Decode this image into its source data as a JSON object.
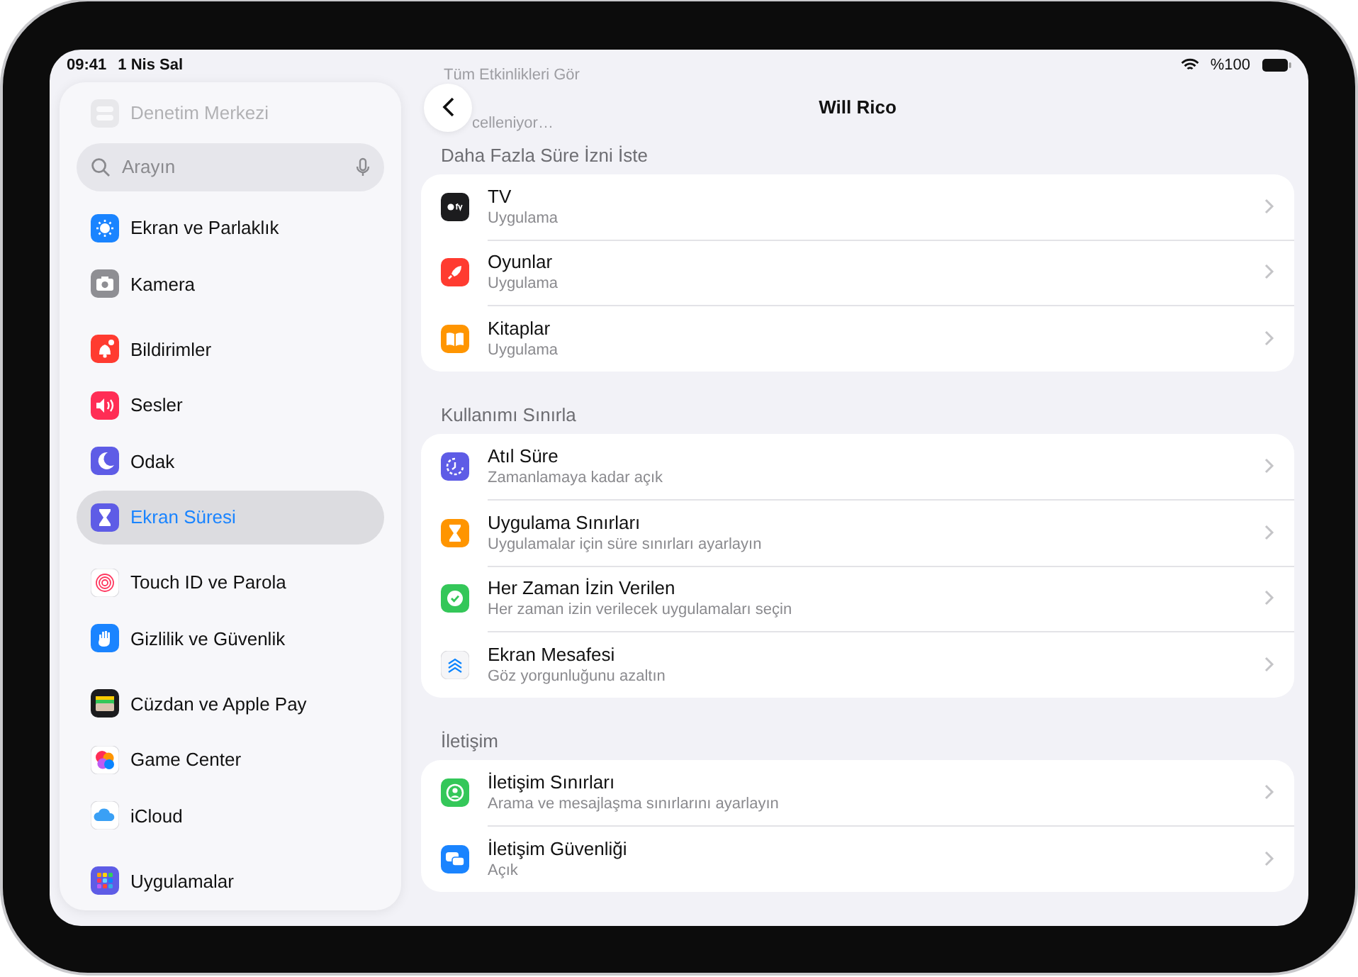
{
  "status_bar": {
    "time": "09:41",
    "date": "1 Nis Sal",
    "battery": "%100"
  },
  "sidebar": {
    "scrolled_item": "Denetim Merkezi",
    "search": {
      "placeholder": "Arayın"
    },
    "groups": [
      [
        {
          "label": "Ekran ve Parlaklık",
          "selected": false,
          "color": "#1a84ff"
        },
        {
          "label": "Kamera",
          "selected": false,
          "color": "#8e8e93"
        }
      ],
      [
        {
          "label": "Bildirimler",
          "selected": false,
          "color": "#ff3b30"
        },
        {
          "label": "Sesler",
          "selected": false,
          "color": "#ff2d55"
        },
        {
          "label": "Odak",
          "selected": false,
          "color": "#5e5ce6"
        },
        {
          "label": "Ekran Süresi",
          "selected": true,
          "color": "#5e5ce6"
        }
      ],
      [
        {
          "label": "Touch ID ve Parola",
          "selected": false,
          "color": "#ffffff"
        },
        {
          "label": "Gizlilik ve Güvenlik",
          "selected": false,
          "color": "#1a84ff"
        }
      ],
      [
        {
          "label": "Cüzdan ve Apple Pay",
          "selected": false,
          "color": "#1c1c1e"
        },
        {
          "label": "Game Center",
          "selected": false,
          "color": "#ffffff"
        },
        {
          "label": "iCloud",
          "selected": false,
          "color": "#ffffff"
        }
      ],
      [
        {
          "label": "Uygulamalar",
          "selected": false,
          "color": "#5e5ce6"
        }
      ]
    ]
  },
  "detail": {
    "scrolled_texts": [
      "Tüm Etkinlikleri Gör",
      "celleniyor…"
    ],
    "title": "Will Rico",
    "sections": [
      {
        "header": "Daha Fazla Süre İzni İste",
        "rows": [
          {
            "title": "TV",
            "subtitle": "Uygulama",
            "color": "#1c1c1e"
          },
          {
            "title": "Oyunlar",
            "subtitle": "Uygulama",
            "color": "#ff3b30"
          },
          {
            "title": "Kitaplar",
            "subtitle": "Uygulama",
            "color": "#ff9500"
          }
        ]
      },
      {
        "header": "Kullanımı Sınırla",
        "rows": [
          {
            "title": "Atıl Süre",
            "subtitle": "Zamanlamaya kadar açık",
            "color": "#5e5ce6"
          },
          {
            "title": "Uygulama Sınırları",
            "subtitle": "Uygulamalar için süre sınırları ayarlayın",
            "color": "#ff9500"
          },
          {
            "title": "Her Zaman İzin Verilen",
            "subtitle": "Her zaman izin verilecek uygulamaları seçin",
            "color": "#34c759"
          },
          {
            "title": "Ekran Mesafesi",
            "subtitle": "Göz yorgunluğunu azaltın",
            "color": "#f5f5f7"
          }
        ]
      },
      {
        "header": "İletişim",
        "rows": [
          {
            "title": "İletişim Sınırları",
            "subtitle": "Arama ve mesajlaşma sınırlarını ayarlayın",
            "color": "#34c759"
          },
          {
            "title": "İletişim Güvenliği",
            "subtitle": "Açık",
            "color": "#1a84ff"
          }
        ]
      }
    ]
  }
}
